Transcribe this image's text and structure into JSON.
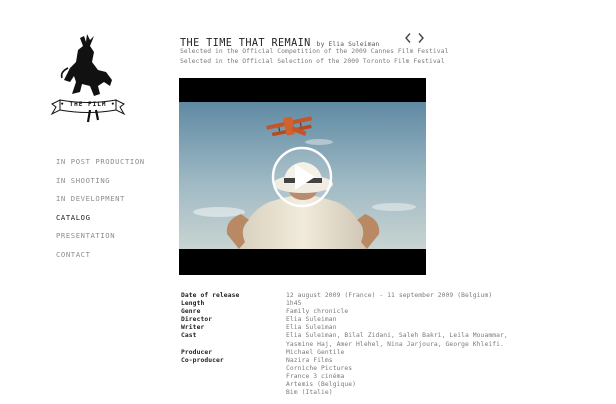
{
  "logo": {
    "text": "• THE FILM •"
  },
  "nav": {
    "items": [
      {
        "label": "IN POST PRODUCTION"
      },
      {
        "label": "IN SHOOTING"
      },
      {
        "label": "IN DEVELOPMENT"
      },
      {
        "label": "CATALOG"
      },
      {
        "label": "PRESENTATION"
      },
      {
        "label": "CONTACT"
      }
    ],
    "active": "CATALOG"
  },
  "film": {
    "title": "THE TIME THAT REMAIN",
    "byline": "by Elia Suleiman",
    "selections": [
      "Selected in the Official Competition of the 2009 Cannes Film Festival",
      "Selected in the Official Selection of the 2009 Toronto Film Festival"
    ]
  },
  "pager": {
    "prev_icon": "chevron-left-icon",
    "next_icon": "chevron-right-icon"
  },
  "video": {
    "play_icon": "play-icon"
  },
  "details": [
    {
      "label": "Date of release",
      "values": [
        "12 august 2009 (France) - 11 september 2009 (Belgium)"
      ]
    },
    {
      "label": "Length",
      "values": [
        "1h45"
      ]
    },
    {
      "label": "Genre",
      "values": [
        "Family chronicle"
      ]
    },
    {
      "label": "Director",
      "values": [
        "Elia Suleiman"
      ]
    },
    {
      "label": "Writer",
      "values": [
        "Elia Suleiman"
      ]
    },
    {
      "label": "Cast",
      "values": [
        "Elia Suleiman, Bilal Zidani, Saleh Bakri, Leila Mouammar,",
        "Yasmine Haj, Amer Hlehel, Nina Jarjoura, George Khleifi."
      ]
    },
    {
      "label": "Producer",
      "values": [
        "Michael Gentile"
      ]
    },
    {
      "label": "Co-producer",
      "values": [
        "Nazira Films",
        "Corniche Pictures",
        "France 3 cinéma",
        "Artemis (Belgique)",
        "Bim (Italie)"
      ]
    }
  ],
  "colors": {
    "nav_inactive": "#8c8c8c",
    "nav_active": "#222222",
    "label": "#222222",
    "value": "#7a7a7a"
  }
}
